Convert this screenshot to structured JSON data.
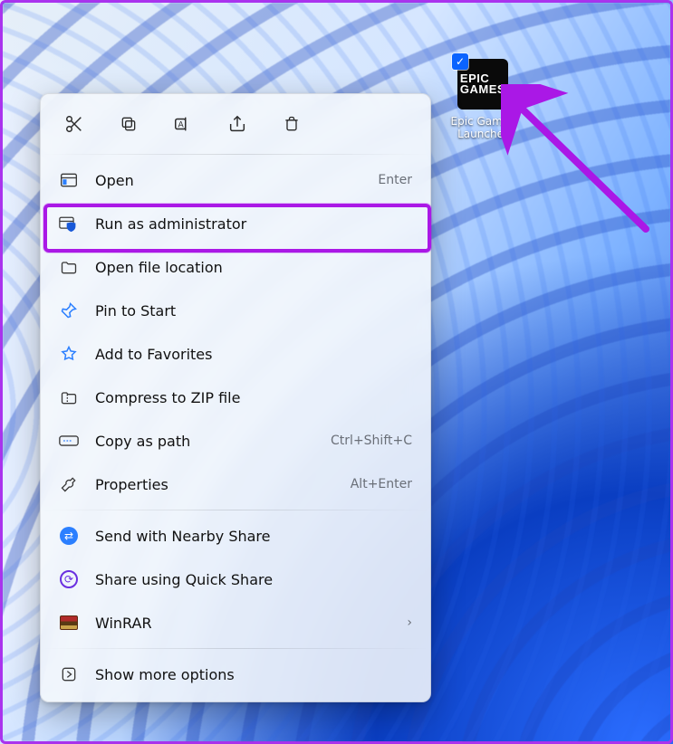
{
  "desktop_icon": {
    "tile_text": "EPIC\nGAMES",
    "label": "Epic Games\nLauncher",
    "selected": true
  },
  "context_menu": {
    "toolbar": {
      "cut": "Cut",
      "copy": "Copy",
      "rename": "Rename",
      "share": "Share",
      "delete": "Delete"
    },
    "items": [
      {
        "icon": "window-icon",
        "label": "Open",
        "accel": "Enter"
      },
      {
        "icon": "admin-shield-icon",
        "label": "Run as administrator",
        "accel": ""
      },
      {
        "icon": "folder-icon",
        "label": "Open file location",
        "accel": ""
      },
      {
        "icon": "pin-icon",
        "label": "Pin to Start",
        "accel": ""
      },
      {
        "icon": "star-icon",
        "label": "Add to Favorites",
        "accel": ""
      },
      {
        "icon": "zip-icon",
        "label": "Compress to ZIP file",
        "accel": ""
      },
      {
        "icon": "path-icon",
        "label": "Copy as path",
        "accel": "Ctrl+Shift+C"
      },
      {
        "icon": "wrench-icon",
        "label": "Properties",
        "accel": "Alt+Enter"
      }
    ],
    "share_items": [
      {
        "icon": "nearby-share-icon",
        "label": "Send with Nearby Share"
      },
      {
        "icon": "quick-share-icon",
        "label": "Share using Quick Share"
      },
      {
        "icon": "winrar-icon",
        "label": "WinRAR",
        "submenu": true
      }
    ],
    "more": {
      "icon": "more-options-icon",
      "label": "Show more options"
    }
  },
  "annotation": {
    "highlight_target": "Run as administrator",
    "arrow_points_to": "Epic Games Launcher desktop icon",
    "color": "#aa18e6"
  }
}
